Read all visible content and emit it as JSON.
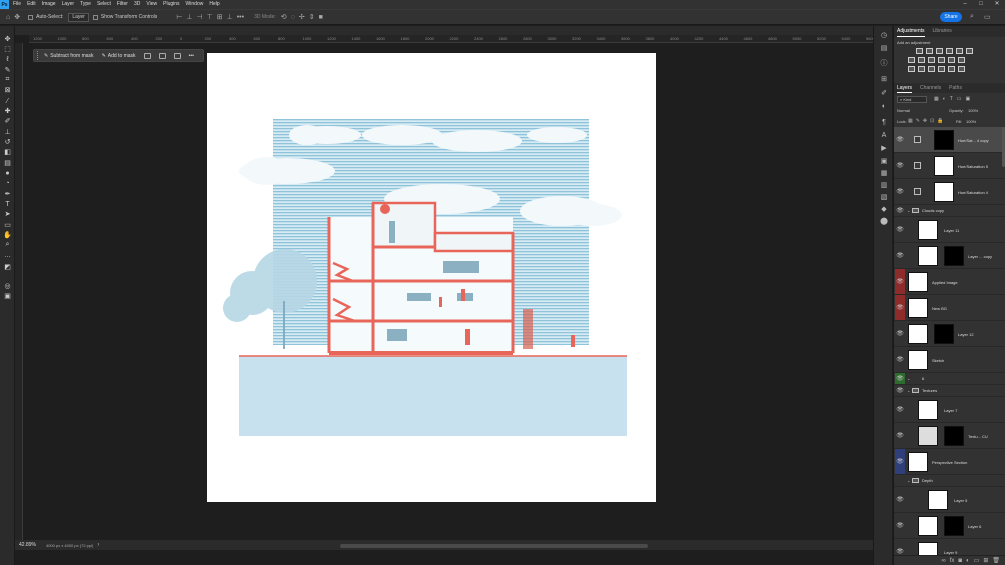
{
  "app": {
    "logo": "Ps"
  },
  "menu": [
    "File",
    "Edit",
    "Image",
    "Layer",
    "Type",
    "Select",
    "Filter",
    "3D",
    "View",
    "Plugins",
    "Window",
    "Help"
  ],
  "options": {
    "auto_select": "Auto-Select:",
    "auto_select_value": "Layer",
    "transform_controls": "Show Transform Controls",
    "mode_3d": "3D Mode:",
    "more": "•••",
    "share": "Share"
  },
  "ruler": [
    "1200",
    "1000",
    "800",
    "600",
    "400",
    "200",
    "0",
    "200",
    "400",
    "600",
    "800",
    "1000",
    "1200",
    "1400",
    "1600",
    "1800",
    "2000",
    "2200",
    "2400",
    "2600",
    "2800",
    "3000",
    "3200",
    "3400",
    "3600",
    "3800",
    "4000",
    "4200",
    "4400",
    "4600",
    "4800",
    "5000",
    "5200",
    "5400",
    "5600"
  ],
  "context": {
    "subtract": "Subtract from mask",
    "add": "Add to mask",
    "more": "•••"
  },
  "status": {
    "zoom": "42.89%",
    "size": "4000 px x 4000 px (72 ppi)"
  },
  "panels": {
    "tabs_top": [
      "Adjustments",
      "Libraries"
    ],
    "add_adjustment": "Add an adjustment",
    "tabs_layers": [
      "Layers",
      "Channels",
      "Paths"
    ],
    "filter_kind": "Kind",
    "blend_mode": "Normal",
    "opacity_label": "Opacity:",
    "opacity_value": "100%",
    "lock_label": "Lock:",
    "fill_label": "Fill:",
    "fill_value": "100%"
  },
  "layers": [
    {
      "name": "Hue/Sat... 4 copy",
      "kind": "adj"
    },
    {
      "name": "Hue/Saturation 5",
      "kind": "adj"
    },
    {
      "name": "Hue/Saturation 4",
      "kind": "adj"
    },
    {
      "name": "Clouds copy",
      "kind": "group"
    },
    {
      "name": "Layer 11",
      "kind": "pixel"
    },
    {
      "name": "Layer ... copy",
      "kind": "masked"
    },
    {
      "name": "Applied Image",
      "kind": "pixel"
    },
    {
      "name": "New BG",
      "kind": "pixel"
    },
    {
      "name": "Layer 12",
      "kind": "masked"
    },
    {
      "name": "Sketch",
      "kind": "pixel"
    },
    {
      "name": "6",
      "kind": "group"
    },
    {
      "name": "Textures",
      "kind": "group"
    },
    {
      "name": "Layer 7",
      "kind": "pixel"
    },
    {
      "name": "Textu... CU",
      "kind": "masked"
    },
    {
      "name": "Perspective Section",
      "kind": "pixel"
    },
    {
      "name": "Depth",
      "kind": "group"
    },
    {
      "name": "Layer 5",
      "kind": "pixel"
    },
    {
      "name": "Layer 6",
      "kind": "masked"
    },
    {
      "name": "Layer 9",
      "kind": "pixel"
    }
  ],
  "colors": {
    "accent": "#1473e6",
    "red_eye": "#8e2b2b",
    "green_eye": "#2e6b2e",
    "blue_eye": "#2e3f7a",
    "section_red": "#e8655a",
    "sky_blue": "#a9d3e6"
  }
}
